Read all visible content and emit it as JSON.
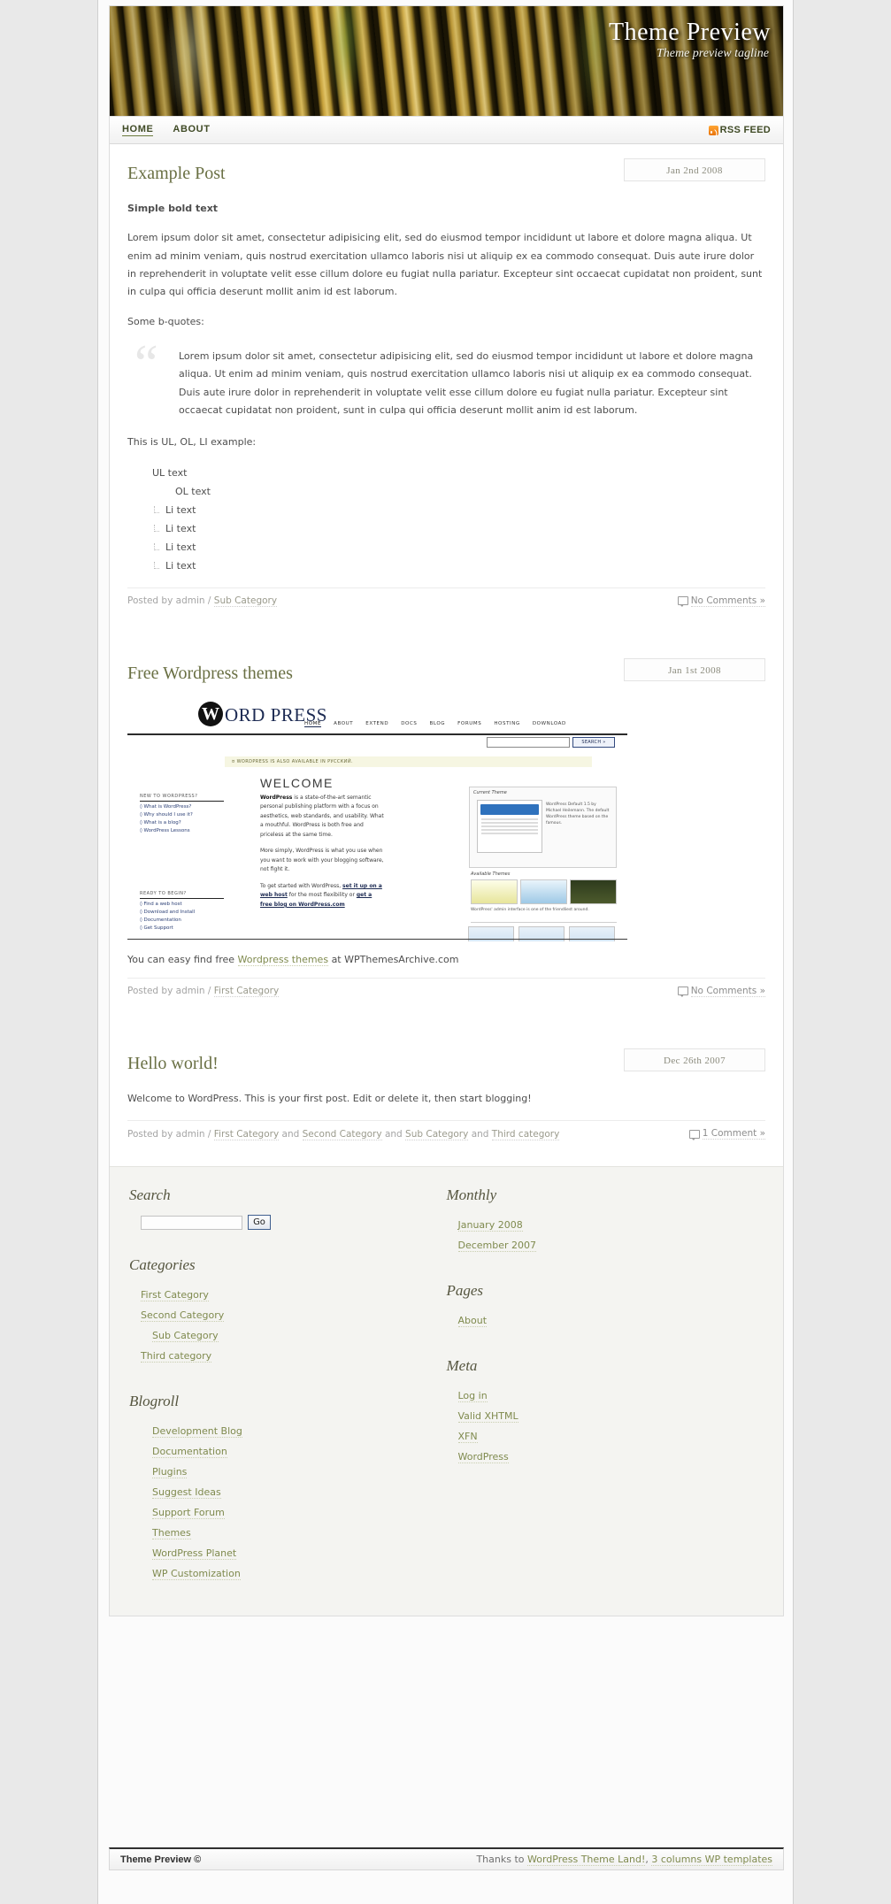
{
  "site": {
    "title": "Theme Preview",
    "tagline": "Theme preview tagline"
  },
  "nav": {
    "items": [
      {
        "label": "HOME",
        "active": true
      },
      {
        "label": "ABOUT",
        "active": false
      }
    ],
    "rss_label": "RSS FEED",
    "rss_icon": "rss-icon"
  },
  "posts": [
    {
      "title": "Example Post",
      "date": "Jan 2nd 2008",
      "bold_lead": "Simple bold text",
      "paragraph": "Lorem ipsum dolor sit amet, consectetur adipisicing elit, sed do eiusmod tempor incididunt ut labore et dolore magna aliqua. Ut enim ad minim veniam, quis nostrud exercitation ullamco laboris nisi ut aliquip ex ea commodo consequat. Duis aute irure dolor in reprehenderit in voluptate velit esse cillum dolore eu fugiat nulla pariatur. Excepteur sint occaecat cupidatat non proident, sunt in culpa qui officia deserunt mollit anim id est laborum.",
      "quote_intro": "Some b-quotes:",
      "quote_mark": "“",
      "quote_text": "Lorem ipsum dolor sit amet, consectetur adipisicing elit, sed do eiusmod tempor incididunt ut labore et dolore magna aliqua. Ut enim ad minim veniam, quis nostrud exercitation ullamco laboris nisi ut aliquip ex ea commodo consequat. Duis aute irure dolor in reprehenderit in voluptate velit esse cillum dolore eu fugiat nulla pariatur. Excepteur sint occaecat cupidatat non proident, sunt in culpa qui officia deserunt mollit anim id est laborum.",
      "list_intro": "This is UL, OL, LI example:",
      "ul_text": "UL text",
      "ol_text": "OL text",
      "li_items": [
        "Li text",
        "Li text",
        "Li text",
        "Li text"
      ],
      "meta_prefix": "Posted by admin /",
      "categories": [
        "Sub Category"
      ],
      "comments": "No Comments »"
    },
    {
      "title": "Free Wordpress themes",
      "date": "Jan 1st 2008",
      "caption_before": "You can easy find free",
      "caption_link": "Wordpress themes",
      "caption_after": "at WPThemesArchive.com",
      "meta_prefix": "Posted by admin /",
      "categories": [
        "First Category"
      ],
      "comments": "No Comments »"
    },
    {
      "title": "Hello world!",
      "date": "Dec 26th 2007",
      "paragraph": "Welcome to WordPress. This is your first post. Edit or delete it, then start blogging!",
      "meta_prefix": "Posted by admin /",
      "categories": [
        "First Category",
        "Second Category",
        "Sub Category",
        "Third category"
      ],
      "category_joiner": "and",
      "comments": "1 Comment »"
    }
  ],
  "wp_screenshot": {
    "logo_mark": "W",
    "logo_word": "ORD PRESS",
    "nav": [
      "HOME",
      "ABOUT",
      "EXTEND",
      "DOCS",
      "BLOG",
      "FORUMS",
      "HOSTING",
      "DOWNLOAD"
    ],
    "search_button": "SEARCH »",
    "notice": "¤ WORDPRESS IS ALSO AVAILABLE IN РУССКИЙ.",
    "welcome": "WELCOME",
    "left_head_1": "NEW TO WORDPRESS?",
    "left_links_1": [
      "◊ What is WordPress?",
      "◊ Why should I use it?",
      "◊ What is a blog?",
      "◊ WordPress Lessons"
    ],
    "left_head_2": "READY TO BEGIN?",
    "left_links_2": [
      "◊ Find a web host",
      "◊ Download and Install",
      "◊ Documentation",
      "◊ Get Support"
    ],
    "body_1_bold": "WordPress",
    "body_1": "is a state-of-the-art semantic personal publishing platform with a focus on aesthetics, web standards, and usability. What a mouthful. WordPress is both free and priceless at the same time.",
    "body_2": "More simply, WordPress is what you use when you want to work with your blogging software, not fight it.",
    "body_3_pre": "To get started with WordPress,",
    "body_3_link1": "set it up on a web host",
    "body_3_mid": "for the most flexibility or",
    "body_3_link2": "get a free blog on WordPress.com",
    "panel_title": "Current Theme",
    "panel_text": "WordPress Default 1.5 by Michael Heilemann. The default WordPress theme based on the famous.",
    "available_themes": "Available Themes",
    "caption": "WordPress' admin interface is one of the friendliest around."
  },
  "sidebar_left": {
    "search": {
      "heading": "Search",
      "value": "",
      "placeholder": "",
      "button": "Go"
    },
    "categories": {
      "heading": "Categories",
      "items": [
        {
          "label": "First Category",
          "sub": false
        },
        {
          "label": "Second Category",
          "sub": false
        },
        {
          "label": "Sub Category",
          "sub": true
        },
        {
          "label": "Third category",
          "sub": false
        }
      ]
    },
    "blogroll": {
      "heading": "Blogroll",
      "items": [
        "Development Blog",
        "Documentation",
        "Plugins",
        "Suggest Ideas",
        "Support Forum",
        "Themes",
        "WordPress Planet",
        "WP Customization"
      ]
    }
  },
  "sidebar_right": {
    "monthly": {
      "heading": "Monthly",
      "items": [
        "January 2008",
        "December 2007"
      ]
    },
    "pages": {
      "heading": "Pages",
      "items": [
        "About"
      ]
    },
    "meta": {
      "heading": "Meta",
      "items": [
        "Log in",
        "Valid XHTML",
        "XFN",
        "WordPress"
      ]
    }
  },
  "footer": {
    "copyright": "Theme Preview ©",
    "thanks_prefix": "Thanks to",
    "link1": "WordPress Theme Land!",
    "separator": ",",
    "link2": "3 columns WP templates"
  },
  "colors": {
    "accent_green": "#7f8a4e",
    "title_green": "#6a7044",
    "rss_orange": "#e8740c"
  }
}
